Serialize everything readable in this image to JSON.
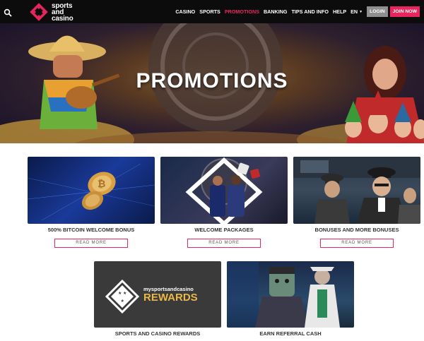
{
  "header": {
    "logo_text_line1": "sports",
    "logo_text_line2": "and",
    "logo_text_line3": "casino",
    "nav_items": [
      "CASINO",
      "SPORTS",
      "PROMOTIONS",
      "BANKING",
      "TIPS AND INFO",
      "HELP"
    ],
    "active_nav": "PROMOTIONS",
    "language": "EN",
    "login_label": "LOGIN",
    "join_label": "JOIN NOW"
  },
  "hero": {
    "title": "PROMOTIONS"
  },
  "promotions": [
    {
      "title": "500% BITCOIN WELCOME BONUS",
      "button": "READ MORE"
    },
    {
      "title": "WELCOME PACKAGES",
      "button": "READ MORE"
    },
    {
      "title": "BONUSES AND MORE BONUSES",
      "button": "READ MORE"
    },
    {
      "title": "SPORTS AND CASINO REWARDS"
    },
    {
      "title": "EARN REFERRAL CASH"
    }
  ],
  "rewards_banner": {
    "line1": "mysportsandcasino",
    "line2": "REWARDS"
  },
  "colors": {
    "accent": "#e8265e",
    "navbar": "#0c0c0c",
    "login_bg": "#8f8f8f"
  },
  "icons": [
    "search-icon",
    "logo-dice-icon",
    "chevron-down-icon"
  ]
}
